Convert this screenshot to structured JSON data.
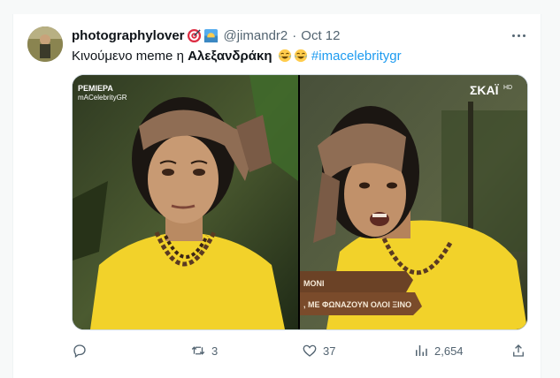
{
  "tweet": {
    "display_name": "photographylover",
    "name_emojis": [
      "target-emoji",
      "sunrise-emoji"
    ],
    "handle": "@jimandr2",
    "separator": "·",
    "date": "Oct 12",
    "text_prefix": "Κινούμενο meme η ",
    "text_bold": "Αλεξανδράκη",
    "text_emojis": [
      "laughing-tears-emoji",
      "laughing-tears-emoji"
    ],
    "hashtag": "#imacelebritygr"
  },
  "media": {
    "left": {
      "overlay_line1": "ΡΕΜΙΕΡΑ",
      "overlay_line2": "mACelebrityGR"
    },
    "right": {
      "logo": "ΣΚΑΪ",
      "logo_suffix": "HD",
      "banner_line1": "ΜΟΝΙ",
      "banner_line2": ", ΜΕ ΦΩΝΑΖΟΥΝ ΟΛΟΙ ΞΙΝΟ"
    }
  },
  "actions": {
    "reply_count": "",
    "retweet_count": "3",
    "like_count": "37",
    "views_count": "2,654"
  },
  "colors": {
    "accent": "#1d9bf0",
    "text_secondary": "#536471",
    "shirt_yellow": "#f2d22a"
  }
}
